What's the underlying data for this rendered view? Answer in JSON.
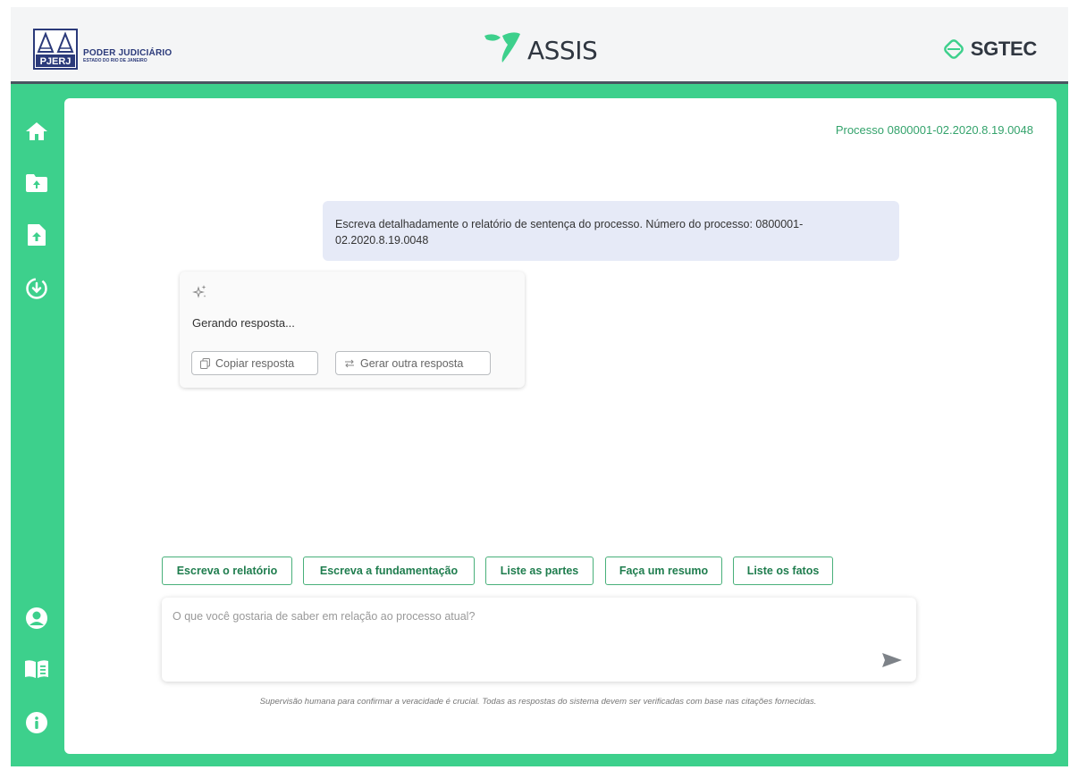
{
  "header": {
    "org_title": "PODER JUDICIÁRIO",
    "org_subtitle": "ESTADO DO RIO DE JANEIRO",
    "org_logo_text": "PJERJ",
    "app_name": "ASSIS",
    "partner_name": "SGTEC"
  },
  "sidebar": {
    "items": [
      {
        "icon": "home-icon"
      },
      {
        "icon": "folder-upload-icon"
      },
      {
        "icon": "file-upload-icon"
      },
      {
        "icon": "download-circle-icon"
      }
    ],
    "bottom_items": [
      {
        "icon": "user-icon"
      },
      {
        "icon": "book-icon"
      },
      {
        "icon": "info-icon"
      }
    ]
  },
  "main": {
    "process_label": "Processo 0800001-02.2020.8.19.0048",
    "user_message": "Escreva detalhadamente o relatório de sentença do processo. Número do processo: 0800001-02.2020.8.19.0048",
    "ai_response": {
      "status_text": "Gerando resposta...",
      "copy_label": "Copiar resposta",
      "regenerate_label": "Gerar outra resposta"
    },
    "suggestions": [
      "Escreva o relatório",
      "Escreva a fundamentação",
      "Liste as partes",
      "Faça um resumo",
      "Liste os fatos"
    ],
    "input": {
      "placeholder": "O que você gostaria de saber em relação ao processo atual?",
      "value": ""
    },
    "disclaimer": "Supervisão humana para confirmar a veracidade é crucial. Todas as respostas do sistema devem ser verificadas com base nas citações fornecidas."
  },
  "colors": {
    "brand_green": "#3dd08c",
    "accent_text_green": "#34a36c",
    "header_bg": "#f4f5f6",
    "user_bubble_bg": "#e6eaf7"
  }
}
